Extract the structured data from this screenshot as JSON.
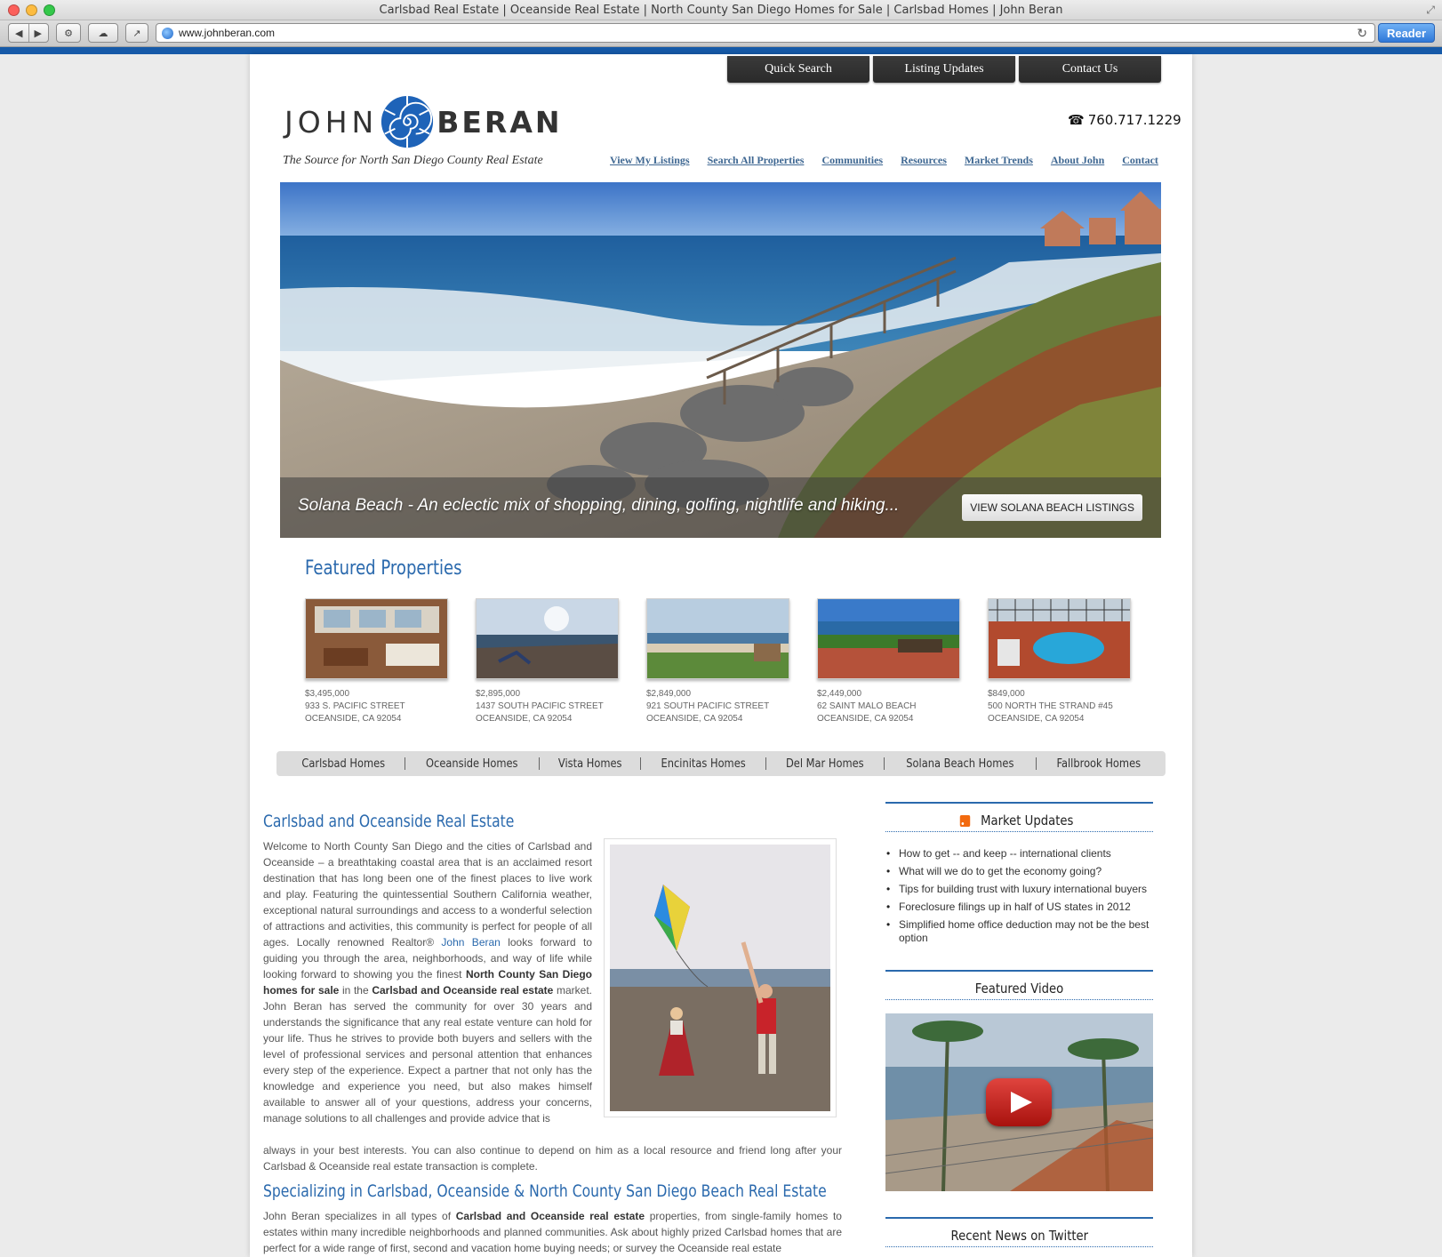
{
  "browser": {
    "window_title": "Carlsbad Real Estate | Oceanside Real Estate | North County San Diego Homes for Sale | Carlsbad Homes | John Beran",
    "url": "www.johnberan.com",
    "reader_label": "Reader"
  },
  "header": {
    "top_buttons": [
      "Quick Search",
      "Listing Updates",
      "Contact Us"
    ],
    "logo_first": "JOHN",
    "logo_last": "BERAN",
    "tagline": "The Source for North San Diego County Real Estate",
    "phone": "760.717.1229",
    "nav": [
      "View My Listings",
      "Search All Properties",
      "Communities",
      "Resources",
      "Market Trends",
      "About John",
      "Contact"
    ]
  },
  "hero": {
    "caption": "Solana Beach - An eclectic mix of shopping, dining, golfing, nightlife and hiking...",
    "button": "VIEW SOLANA BEACH LISTINGS"
  },
  "featured": {
    "title": "Featured Properties",
    "properties": [
      {
        "price": "$3,495,000",
        "street": "933 S. PACIFIC STREET",
        "city": "OCEANSIDE, CA 92054"
      },
      {
        "price": "$2,895,000",
        "street": "1437 SOUTH PACIFIC STREET",
        "city": "OCEANSIDE, CA 92054"
      },
      {
        "price": "$2,849,000",
        "street": "921 SOUTH PACIFIC STREET",
        "city": "OCEANSIDE, CA 92054"
      },
      {
        "price": "$2,449,000",
        "street": "62 SAINT MALO BEACH",
        "city": "OCEANSIDE, CA 92054"
      },
      {
        "price": "$849,000",
        "street": "500 NORTH THE STRAND #45",
        "city": "OCEANSIDE, CA 92054"
      }
    ]
  },
  "communities": [
    "Carlsbad Homes",
    "Oceanside Homes",
    "Vista Homes",
    "Encinitas Homes",
    "Del Mar Homes",
    "Solana Beach Homes",
    "Fallbrook Homes"
  ],
  "content": {
    "heading1": "Carlsbad and Oceanside Real Estate",
    "p1_a": "Welcome to North County San Diego and the cities of Carlsbad and Oceanside – a breathtaking coastal area that is an acclaimed resort destination that has long been one of the finest places to live work and play. Featuring the quintessential Southern California weather, exceptional natural surroundings and access to a wonderful selection of attractions and activities, this community is perfect for people of all ages. Locally renowned Realtor®",
    "p1_link": "John Beran",
    "p1_b": "looks forward to guiding you through the area, neighborhoods, and way of life while looking forward to showing you the finest",
    "p1_bold1": "North County San Diego homes for sale",
    "p1_c": "in the",
    "p1_bold2": "Carlsbad and Oceanside real estate",
    "p1_d": "market. John Beran has served the community for over 30 years and understands the significance that any real estate venture can hold for your life. Thus he strives to provide both buyers and sellers with the level of professional services and personal attention that enhances every step of the experience. Expect a partner that not only has the knowledge and experience you need, but also makes himself available to answer all of your questions, address your concerns, manage solutions to all challenges and provide advice that is",
    "p1_e": "always in your best interests. You can also continue to depend on him as a local resource and friend long after your Carlsbad & Oceanside real estate transaction is complete.",
    "heading2": "Specializing in Carlsbad, Oceanside & North County San Diego Beach Real Estate",
    "p2_a": "John Beran specializes in all types of",
    "p2_bold": "Carlsbad and Oceanside real estate",
    "p2_b": "properties, from single-family homes to estates within many incredible neighborhoods and planned communities. Ask about highly prized Carlsbad homes that are perfect for a wide range of first, second and vacation home buying needs; or survey the Oceanside real estate"
  },
  "sidebar": {
    "market_title": "Market Updates",
    "news": [
      "How to get -- and keep -- international clients",
      "What will we do to get the economy going?",
      "Tips for building trust with luxury international buyers",
      "Foreclosure filings up in half of US states in 2012",
      "Simplified home office deduction may not be the best option"
    ],
    "video_title": "Featured Video",
    "twitter_title": "Recent News on Twitter"
  }
}
